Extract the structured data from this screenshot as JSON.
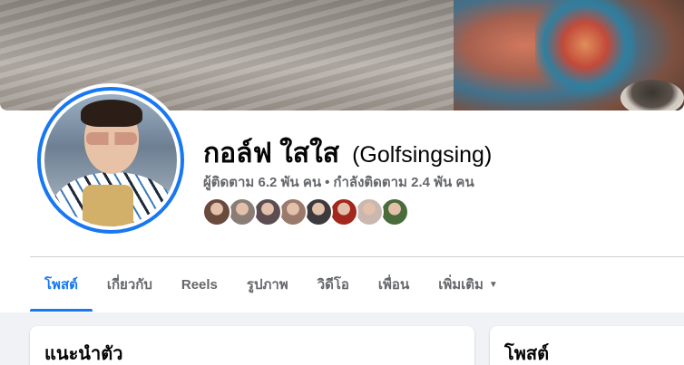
{
  "profile": {
    "name": "กอล์ฟ ใสใส",
    "alternate_name": "(Golfsingsing)",
    "followers": "ผู้ติดตาม 6.2 พัน คน",
    "separator": "•",
    "following": "กำลังติดตาม 2.4 พัน คน"
  },
  "friends": [
    {
      "name": "friend-1",
      "color": "#6b4a3e"
    },
    {
      "name": "friend-2",
      "color": "#8a7d76"
    },
    {
      "name": "friend-3",
      "color": "#5b4d52"
    },
    {
      "name": "friend-4",
      "color": "#9a7a6a"
    },
    {
      "name": "friend-5",
      "color": "#3d3a3d"
    },
    {
      "name": "friend-6",
      "color": "#a2271c"
    },
    {
      "name": "friend-7",
      "color": "#c9b7b0"
    },
    {
      "name": "friend-8",
      "color": "#4a6b3a"
    }
  ],
  "tabs": [
    {
      "label": "โพสต์",
      "active": true
    },
    {
      "label": "เกี่ยวกับ",
      "active": false
    },
    {
      "label": "Reels",
      "active": false
    },
    {
      "label": "รูปภาพ",
      "active": false
    },
    {
      "label": "วิดีโอ",
      "active": false
    },
    {
      "label": "เพื่อน",
      "active": false
    },
    {
      "label": "เพิ่มเติม",
      "active": false,
      "caret": "▼"
    }
  ],
  "cards": {
    "intro_title": "แนะนำตัว",
    "posts_title": "โพสต์"
  },
  "colors": {
    "accent": "#1877f2",
    "secondary_text": "#65676b",
    "page_background": "#f0f2f5"
  }
}
